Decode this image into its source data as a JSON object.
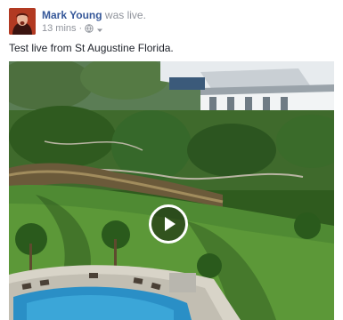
{
  "post": {
    "author_name": "Mark Young",
    "action_text": "was live.",
    "timestamp": "13 mins",
    "separator": "·",
    "privacy_icon": "globe-icon",
    "menu_icon": "caret-down-icon",
    "status_text": "Test live from St Augustine Florida."
  },
  "video": {
    "play_icon": "play-icon"
  },
  "colors": {
    "author_link": "#365899",
    "meta_gray": "#90949c",
    "body_text": "#1d2129"
  }
}
